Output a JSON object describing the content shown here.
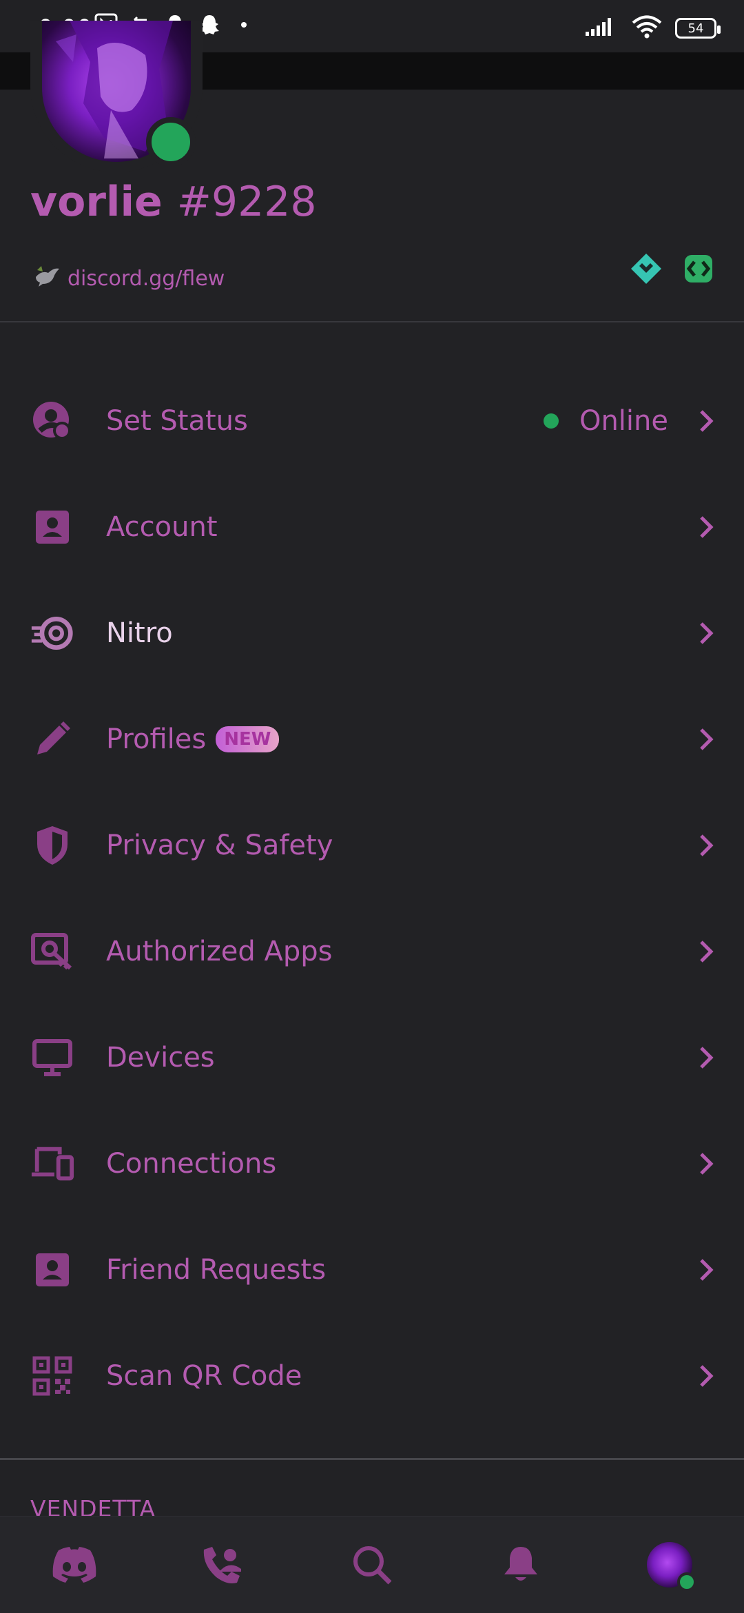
{
  "status_bar": {
    "time": "0:00",
    "battery": "54",
    "left_icons": [
      "nfc-icon",
      "sync-icon",
      "snapchat-icon",
      "snapchat-icon",
      "dot-icon"
    ],
    "right_icons": [
      "signal-icon",
      "wifi-icon",
      "battery-icon"
    ]
  },
  "profile": {
    "username": "vorlie",
    "discriminator": "#9228",
    "bio": "discord.gg/flew",
    "status_color": "#23a55a",
    "badges": [
      "hypesquad-icon",
      "active-developer-icon"
    ]
  },
  "menu": {
    "items": [
      {
        "label": "Set Status",
        "icon": "status-icon",
        "value": "Online"
      },
      {
        "label": "Account",
        "icon": "account-icon"
      },
      {
        "label": "Nitro",
        "icon": "nitro-icon"
      },
      {
        "label": "Profiles",
        "icon": "pencil-icon",
        "badge": "NEW"
      },
      {
        "label": "Privacy & Safety",
        "icon": "shield-icon"
      },
      {
        "label": "Authorized Apps",
        "icon": "authorized-apps-icon"
      },
      {
        "label": "Devices",
        "icon": "monitor-icon"
      },
      {
        "label": "Connections",
        "icon": "connections-icon"
      },
      {
        "label": "Friend Requests",
        "icon": "friend-requests-icon"
      },
      {
        "label": "Scan QR Code",
        "icon": "qr-code-icon"
      }
    ]
  },
  "section": {
    "title": "VENDETTA"
  },
  "tabbar": {
    "tabs": [
      "home-tab",
      "friends-tab",
      "search-tab",
      "notifications-tab",
      "profile-tab"
    ]
  },
  "colors": {
    "accent": "#b45bb0",
    "background": "#222225",
    "online": "#23a55a"
  }
}
